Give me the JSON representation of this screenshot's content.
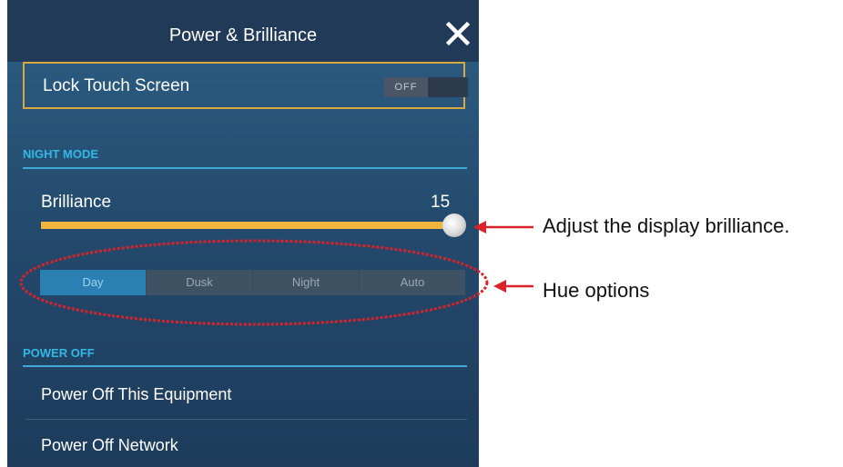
{
  "dialog": {
    "title": "Power & Brilliance",
    "close_icon": "close-icon"
  },
  "lock_touch_screen": {
    "label": "Lock Touch Screen",
    "toggle_state": "OFF"
  },
  "night_mode": {
    "section_title": "NIGHT MODE",
    "brilliance_label": "Brilliance",
    "brilliance_value": "15",
    "brilliance_level": 1.0,
    "hue_options": [
      "Day",
      "Dusk",
      "Night",
      "Auto"
    ],
    "hue_selected": "Day"
  },
  "power_off": {
    "section_title": "POWER OFF",
    "items": [
      "Power Off This Equipment",
      "Power Off Network"
    ]
  },
  "annotations": {
    "brilliance_callout": "Adjust the display brilliance.",
    "hue_callout": "Hue options"
  },
  "colors": {
    "panel_background": "#23496c",
    "accent_orange": "#f0b53c",
    "section_blue": "#33b8e5",
    "selected_hue": "#2b80b3",
    "callout_red": "#d9222a"
  }
}
